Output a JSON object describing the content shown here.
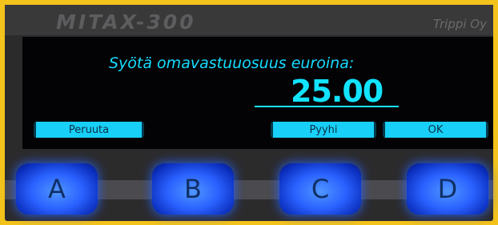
{
  "device": {
    "brand": "MITAX-300",
    "maker": "Trippi Oy"
  },
  "screen": {
    "prompt": "Syötä omavastuuosuus euroina:",
    "value": "25.00",
    "softkeys": {
      "a": "Peruuta",
      "b": "",
      "c": "Pyyhi",
      "d": "OK"
    }
  },
  "buttons": [
    "A",
    "B",
    "C",
    "D"
  ],
  "colors": {
    "lcd_text": "#12e3ff",
    "softkey_bg": "#18cff7",
    "button_glow": "#2a61ff",
    "frame": "#f3c21b"
  }
}
